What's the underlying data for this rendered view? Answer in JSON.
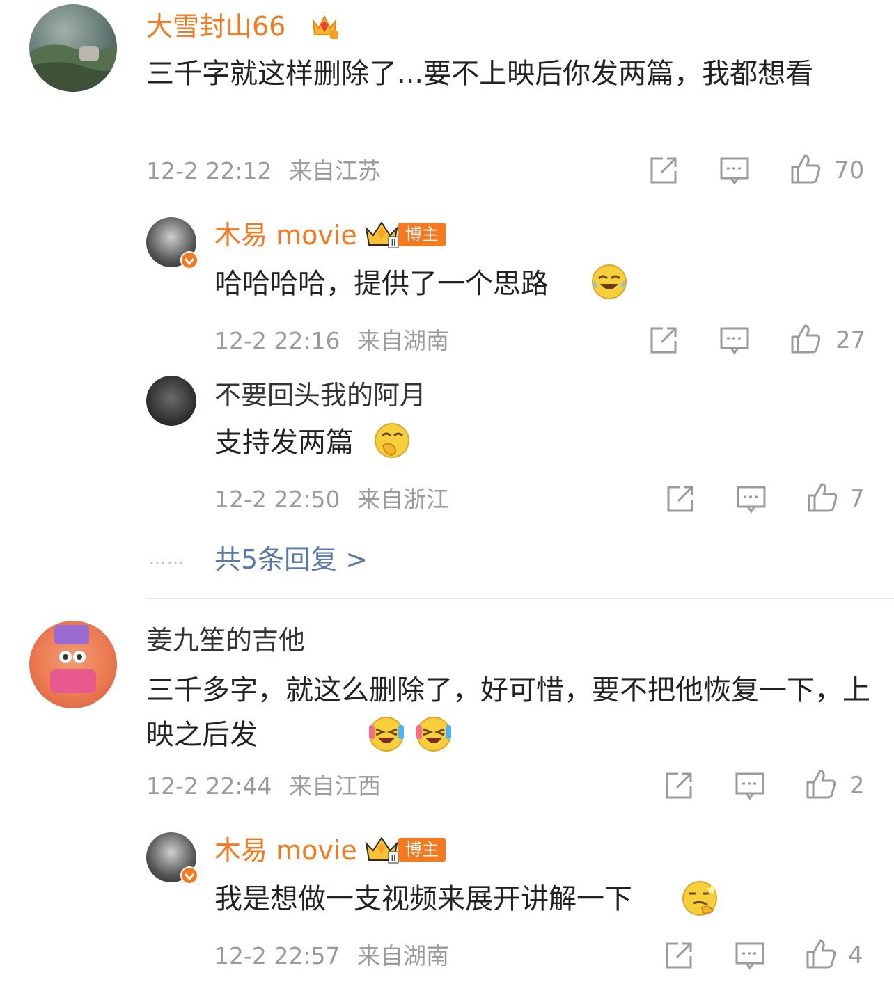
{
  "comments": [
    {
      "user": "大雪封山66",
      "text": "三千字就这样删除了...要不上映后你发两篇，我都想看",
      "time": "12-2 22:12",
      "location": "来自江苏",
      "likes": "70"
    },
    {
      "user": "姜九笙的吉他",
      "text": "三千多字，就这么删除了，好可惜，要不把他恢复一下，上映之后发",
      "time": "12-2 22:44",
      "location": "来自江西",
      "likes": "2"
    }
  ],
  "replies": [
    {
      "user": "木易 movie",
      "tag": "博主",
      "text": "哈哈哈哈，提供了一个思路",
      "time": "12-2 22:16",
      "location": "来自湖南",
      "likes": "27"
    },
    {
      "user": "不要回头我的阿月",
      "text": "支持发两篇",
      "time": "12-2 22:50",
      "location": "来自浙江",
      "likes": "7"
    },
    {
      "user": "木易 movie",
      "tag": "博主",
      "text": "我是想做一支视频来展开讲解一下",
      "time": "12-2 22:57",
      "location": "来自湖南",
      "likes": "4"
    }
  ],
  "more_replies": {
    "dots": "……",
    "label": "共5条回复 >"
  },
  "colors": {
    "orange_name": "#f5791f",
    "link_blue": "#5a78a8",
    "meta_gray": "#9b9b9b"
  },
  "icons": [
    "crown-icon",
    "verified-icon",
    "share-icon",
    "comment-icon",
    "like-icon",
    "laugh-cry-emoji",
    "cover-mouth-emoji",
    "joy-emoji",
    "smug-emoji"
  ]
}
